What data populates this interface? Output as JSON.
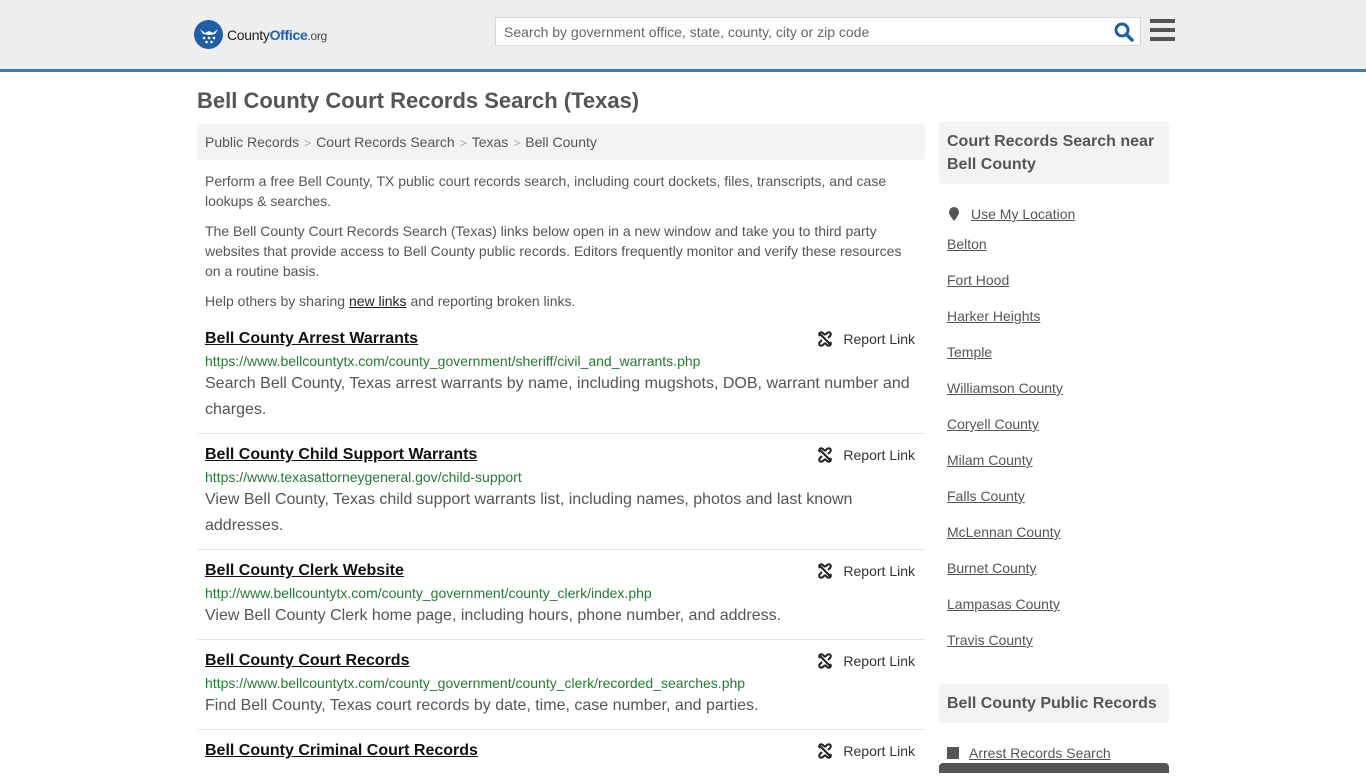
{
  "header": {
    "logo": {
      "brand_plain": "County",
      "brand_bold": "Office",
      "brand_tld": ".org"
    },
    "search": {
      "placeholder": "Search by government office, state, county, city or zip code",
      "value": ""
    },
    "icons": {
      "search": "search-icon",
      "menu": "hamburger-menu-icon",
      "logo": "eagle-stars-badge-icon"
    },
    "colors": {
      "accent": "#3f7bab",
      "brand_blue": "#1f5fa8"
    }
  },
  "page": {
    "title": "Bell County Court Records Search (Texas)",
    "breadcrumb": [
      {
        "label": "Public Records"
      },
      {
        "label": "Court Records Search"
      },
      {
        "label": "Texas"
      },
      {
        "label": "Bell County"
      }
    ],
    "breadcrumb_separator": ">",
    "intro": {
      "p1": "Perform a free Bell County, TX public court records search, including court dockets, files, transcripts, and case lookups & searches.",
      "p2": "The Bell County Court Records Search (Texas) links below open in a new window and take you to third party websites that provide access to Bell County public records. Editors frequently monitor and verify these resources on a routine basis.",
      "p3_before": "Help others by sharing ",
      "p3_link": "new links",
      "p3_after": " and reporting broken links."
    }
  },
  "results": [
    {
      "title": "Bell County Arrest Warrants",
      "url": "https://www.bellcountytx.com/county_government/sheriff/civil_and_warrants.php",
      "description": "Search Bell County, Texas arrest warrants by name, including mugshots, DOB, warrant number and charges.",
      "report_label": "Report Link"
    },
    {
      "title": "Bell County Child Support Warrants",
      "url": "https://www.texasattorneygeneral.gov/child-support",
      "description": "View Bell County, Texas child support warrants list, including names, photos and last known addresses.",
      "report_label": "Report Link"
    },
    {
      "title": "Bell County Clerk Website",
      "url": "http://www.bellcountytx.com/county_government/county_clerk/index.php",
      "description": "View Bell County Clerk home page, including hours, phone number, and address.",
      "report_label": "Report Link"
    },
    {
      "title": "Bell County Court Records",
      "url": "https://www.bellcountytx.com/county_government/county_clerk/recorded_searches.php",
      "description": "Find Bell County, Texas court records by date, time, case number, and parties.",
      "report_label": "Report Link"
    },
    {
      "title": "Bell County Criminal Court Records",
      "url": "",
      "description": "",
      "report_label": "Report Link"
    }
  ],
  "sidebar": {
    "nearby_heading": "Court Records Search near Bell County",
    "use_location": "Use My Location",
    "nearby": [
      "Belton",
      "Fort Hood",
      "Harker Heights",
      "Temple",
      "Williamson County",
      "Coryell County",
      "Milam County",
      "Falls County",
      "McLennan County",
      "Burnet County",
      "Lampasas County",
      "Travis County"
    ],
    "public_records_heading": "Bell County Public Records",
    "public_records": [
      "Arrest Records Search"
    ]
  }
}
